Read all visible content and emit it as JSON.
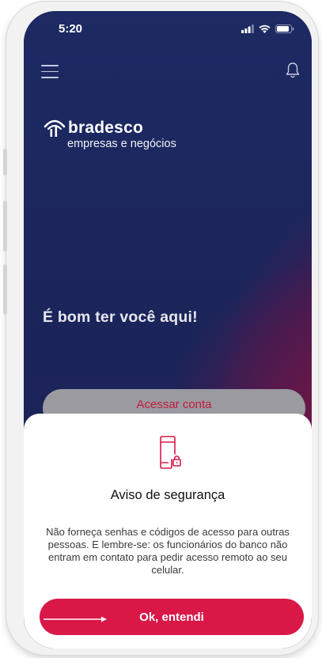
{
  "status_bar": {
    "time": "5:20",
    "icons": [
      "signal-icon",
      "wifi-icon",
      "battery-icon"
    ]
  },
  "top_bar": {
    "menu_icon": "hamburger-menu-icon",
    "notification_icon": "bell-icon"
  },
  "brand": {
    "name": "bradesco",
    "subtitle": "empresas e negócios",
    "logo_icon": "bradesco-tree-logo-icon"
  },
  "main": {
    "welcome": "É bom ter você aqui!",
    "access_button": "Acessar conta"
  },
  "security_notice": {
    "icon": "phone-lock-icon",
    "title": "Aviso de segurança",
    "message": "Não forneça senhas e códigos de acesso para outras pessoas. E lembre-se: os funcionários do banco não entram em contato para pedir acesso remoto ao seu celular.",
    "confirm_button": "Ok, entendi"
  },
  "colors": {
    "background_navy": "#1c2457",
    "accent_red": "#d91848",
    "access_text_red": "#c41b3e"
  }
}
